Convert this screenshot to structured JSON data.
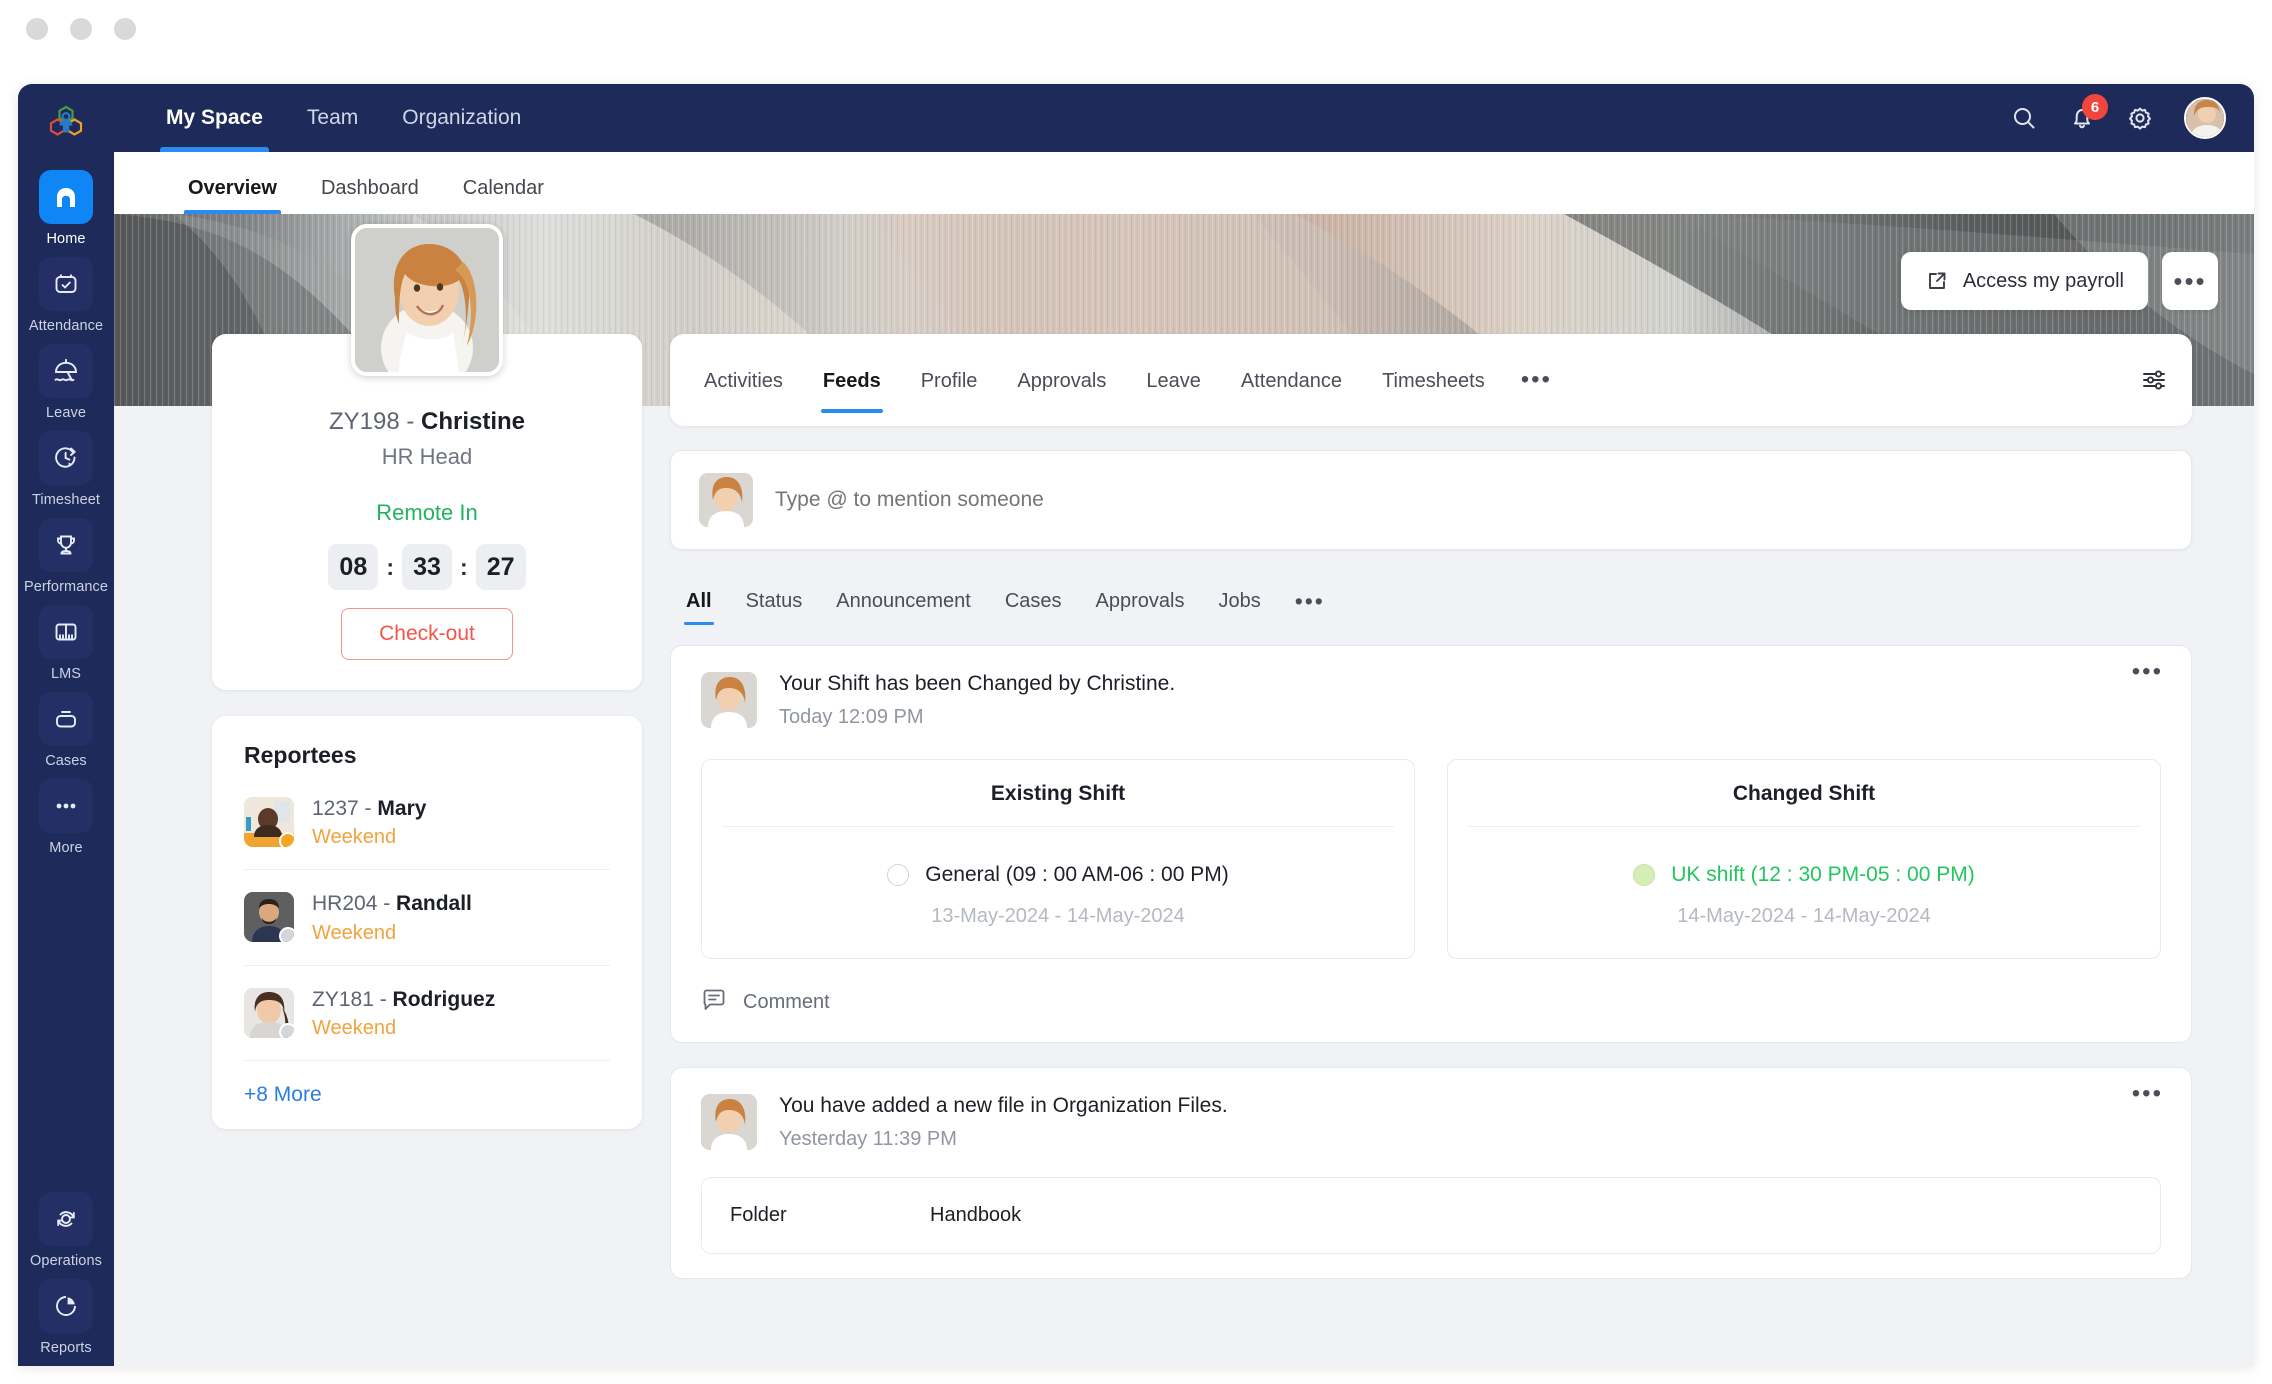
{
  "window": {
    "dots": 3
  },
  "topbar": {
    "logo_icon": "zoho-people-logo-icon",
    "nav": [
      {
        "label": "My Space",
        "active": true
      },
      {
        "label": "Team",
        "active": false
      },
      {
        "label": "Organization",
        "active": false
      }
    ],
    "search_icon": "search-icon",
    "bell_icon": "bell-icon",
    "notification_count": "6",
    "settings_icon": "gear-icon",
    "avatar": "user-avatar"
  },
  "subtabs": [
    {
      "label": "Overview",
      "active": true
    },
    {
      "label": "Dashboard",
      "active": false
    },
    {
      "label": "Calendar",
      "active": false
    }
  ],
  "sidebar": {
    "items": [
      {
        "label": "Home",
        "icon": "home-icon",
        "active": true
      },
      {
        "label": "Attendance",
        "icon": "calendar-check-icon",
        "active": false
      },
      {
        "label": "Leave",
        "icon": "beach-umbrella-icon",
        "active": false
      },
      {
        "label": "Timesheet",
        "icon": "timer-play-icon",
        "active": false
      },
      {
        "label": "Performance",
        "icon": "trophy-icon",
        "active": false
      },
      {
        "label": "LMS",
        "icon": "book-open-icon",
        "active": false
      },
      {
        "label": "Cases",
        "icon": "briefcase-icon",
        "active": false
      },
      {
        "label": "More",
        "icon": "ellipsis-icon",
        "active": false
      }
    ],
    "bottom_items": [
      {
        "label": "Operations",
        "icon": "refresh-cycle-icon",
        "active": false
      },
      {
        "label": "Reports",
        "icon": "pie-chart-icon",
        "active": false
      }
    ]
  },
  "banner": {
    "payroll_button": "Access my payroll",
    "payroll_icon": "external-link-icon",
    "more_button": "•••"
  },
  "profile": {
    "photo": "christine-photo",
    "id": "ZY198 - ",
    "name": "Christine",
    "role": "HR Head",
    "status": "Remote In",
    "timer": {
      "hours": "08",
      "minutes": "33",
      "seconds": "27",
      "sep": ":"
    },
    "checkout_label": "Check-out"
  },
  "reportees": {
    "title": "Reportees",
    "items": [
      {
        "id": "1237 - ",
        "name": "Mary",
        "status": "Weekend",
        "presence": "online"
      },
      {
        "id": "HR204 - ",
        "name": "Randall",
        "status": "Weekend",
        "presence": "offline"
      },
      {
        "id": "ZY181 - ",
        "name": "Rodriguez",
        "status": "Weekend",
        "presence": "offline"
      }
    ],
    "more_label": "+8 More"
  },
  "feed_tabs": {
    "items": [
      {
        "label": "Activities",
        "active": false
      },
      {
        "label": "Feeds",
        "active": true
      },
      {
        "label": "Profile",
        "active": false
      },
      {
        "label": "Approvals",
        "active": false
      },
      {
        "label": "Leave",
        "active": false
      },
      {
        "label": "Attendance",
        "active": false
      },
      {
        "label": "Timesheets",
        "active": false
      }
    ],
    "overflow": "•••",
    "filter_icon": "sliders-icon"
  },
  "composer": {
    "avatar": "user-avatar",
    "placeholder": "Type @ to mention someone",
    "value": ""
  },
  "feed_filters": {
    "items": [
      {
        "label": "All",
        "active": true
      },
      {
        "label": "Status",
        "active": false
      },
      {
        "label": "Announcement",
        "active": false
      },
      {
        "label": "Cases",
        "active": false
      },
      {
        "label": "Approvals",
        "active": false
      },
      {
        "label": "Jobs",
        "active": false
      }
    ],
    "overflow": "•••"
  },
  "posts": [
    {
      "avatar": "christine-avatar",
      "title": "Your Shift has been Changed by Christine.",
      "time": "Today 12:09 PM",
      "more": "•••",
      "shifts": {
        "existing": {
          "heading": "Existing Shift",
          "name": "General (09 : 00 AM-06 : 00 PM)",
          "dates": "13-May-2024 - 14-May-2024",
          "selected": false
        },
        "changed": {
          "heading": "Changed Shift",
          "name": "UK shift (12 : 30 PM-05 : 00 PM)",
          "dates": "14-May-2024 - 14-May-2024",
          "selected": true
        }
      },
      "comment_label": "Comment",
      "comment_icon": "comment-icon"
    },
    {
      "avatar": "christine-avatar",
      "title": "You have added a new file in Organization Files.",
      "time": "Yesterday 11:39 PM",
      "more": "•••",
      "file": {
        "key": "Folder",
        "value": "Handbook"
      }
    }
  ],
  "colors": {
    "navy": "#1e2a59",
    "accent_blue": "#2a8cf0",
    "green": "#21b45e",
    "red": "#f4544a",
    "orange": "#f2a33c",
    "badge_red": "#f1453d"
  }
}
